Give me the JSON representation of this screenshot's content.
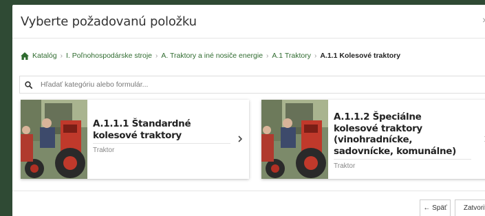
{
  "modal": {
    "title": "Vyberte požadovanú položku",
    "close_glyph": "×"
  },
  "breadcrumb": {
    "items": [
      "Katalóg",
      "I. Poľnohospodárske stroje",
      "A. Traktory a iné nosiče energie",
      "A.1 Traktory",
      "A.1.1 Kolesové traktory"
    ],
    "separator": "›"
  },
  "search": {
    "placeholder": "Hľadať kategóriu alebo formulár..."
  },
  "cards": [
    {
      "title": "A.1.1.1 Štandardné kolesové traktory",
      "subtitle": "Traktor"
    },
    {
      "title": "A.1.1.2 Špeciálne kolesové traktory (vinohradnícke, sadovnícke, komunálne)",
      "subtitle": "Traktor"
    }
  ],
  "footer": {
    "back_label": "← Späť",
    "close_label": "Zatvoriť"
  },
  "colors": {
    "backdrop": "#2f4a34",
    "link_green": "#2f6b2f",
    "tractor_red": "#c0392b"
  }
}
